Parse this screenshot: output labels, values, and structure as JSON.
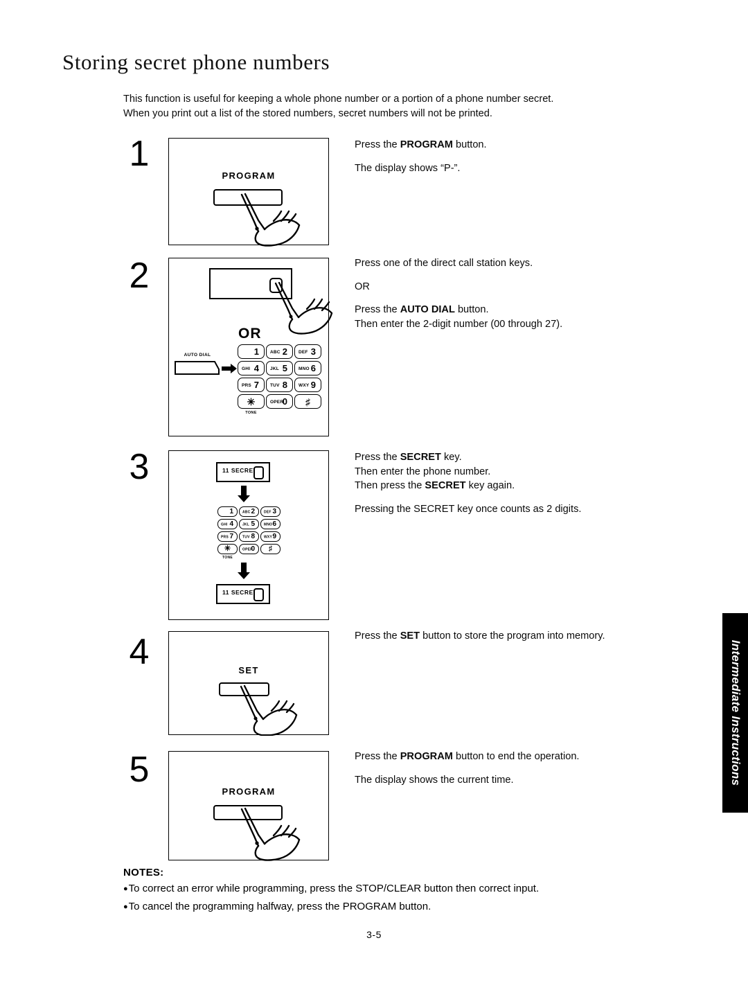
{
  "document": {
    "title": "Storing secret phone numbers",
    "intro_lines": [
      "This function is useful for keeping a whole phone number or a portion of a phone number secret.",
      "When you print out a list of the stored numbers, secret numbers will not be printed."
    ],
    "page_number": "3-5"
  },
  "side_tab": {
    "label": "Intermediate Instructions",
    "background": "#000000",
    "text_color": "#ffffff"
  },
  "steps": [
    {
      "number": "1",
      "figure": {
        "button_label": "PROGRAM",
        "hand": "pointing-hand"
      },
      "text_lines": [
        {
          "prefix": "Press the ",
          "bold": "PROGRAM",
          "suffix": " button."
        },
        {
          "prefix": "",
          "bold": "",
          "suffix": ""
        },
        {
          "prefix": "The display shows “P-”.",
          "bold": "",
          "suffix": ""
        }
      ]
    },
    {
      "number": "2",
      "figure": {
        "or_label": "OR",
        "auto_dial_label": "AUTO DIAL",
        "keypad": [
          [
            {
              "letters": "",
              "digit": "1"
            },
            {
              "letters": "ABC",
              "digit": "2"
            },
            {
              "letters": "DEF",
              "digit": "3"
            }
          ],
          [
            {
              "letters": "GHI",
              "digit": "4"
            },
            {
              "letters": "JKL",
              "digit": "5"
            },
            {
              "letters": "MNO",
              "digit": "6"
            }
          ],
          [
            {
              "letters": "PRS",
              "digit": "7"
            },
            {
              "letters": "TUV",
              "digit": "8"
            },
            {
              "letters": "WXY",
              "digit": "9"
            }
          ],
          [
            {
              "letters": "",
              "digit": "✳",
              "sub": "TONE"
            },
            {
              "letters": "OPER",
              "digit": "0"
            },
            {
              "letters": "",
              "digit": "♯"
            }
          ]
        ]
      },
      "text_lines": [
        {
          "prefix": "Press one of the direct call station keys.",
          "bold": "",
          "suffix": ""
        },
        {
          "prefix": "",
          "bold": "",
          "suffix": ""
        },
        {
          "prefix": "OR",
          "bold": "",
          "suffix": ""
        },
        {
          "prefix": "",
          "bold": "",
          "suffix": ""
        },
        {
          "prefix": "Press the ",
          "bold": "AUTO DIAL",
          "suffix": " button."
        },
        {
          "prefix": "Then enter the 2-digit number (00 through 27).",
          "bold": "",
          "suffix": ""
        }
      ]
    },
    {
      "number": "3",
      "figure": {
        "secret_label_top": "11 SECRET",
        "secret_label_bottom": "11 SECRET",
        "keypad": [
          [
            {
              "letters": "",
              "digit": "1"
            },
            {
              "letters": "ABC",
              "digit": "2"
            },
            {
              "letters": "DEF",
              "digit": "3"
            }
          ],
          [
            {
              "letters": "GHI",
              "digit": "4"
            },
            {
              "letters": "JKL",
              "digit": "5"
            },
            {
              "letters": "MNO",
              "digit": "6"
            }
          ],
          [
            {
              "letters": "PRS",
              "digit": "7"
            },
            {
              "letters": "TUV",
              "digit": "8"
            },
            {
              "letters": "WXY",
              "digit": "9"
            }
          ],
          [
            {
              "letters": "",
              "digit": "✳",
              "sub": "TONE"
            },
            {
              "letters": "OPER",
              "digit": "0"
            },
            {
              "letters": "",
              "digit": "♯"
            }
          ]
        ]
      },
      "text_lines": [
        {
          "prefix": "Press the ",
          "bold": "SECRET",
          "suffix": " key."
        },
        {
          "prefix": "Then enter the phone number.",
          "bold": "",
          "suffix": ""
        },
        {
          "prefix": "Then press the ",
          "bold": "SECRET",
          "suffix": " key again."
        },
        {
          "prefix": "",
          "bold": "",
          "suffix": ""
        },
        {
          "prefix": "Pressing the SECRET key once counts as 2 digits.",
          "bold": "",
          "suffix": ""
        }
      ]
    },
    {
      "number": "4",
      "figure": {
        "button_label": "SET",
        "hand": "pointing-hand"
      },
      "text_lines": [
        {
          "prefix": "Press the ",
          "bold": "SET",
          "suffix": " button to store the program into memory."
        }
      ]
    },
    {
      "number": "5",
      "figure": {
        "button_label": "PROGRAM",
        "hand": "pointing-hand"
      },
      "text_lines": [
        {
          "prefix": "Press the ",
          "bold": "PROGRAM",
          "suffix": " button to end the operation."
        },
        {
          "prefix": "",
          "bold": "",
          "suffix": ""
        },
        {
          "prefix": "The display shows the current time.",
          "bold": "",
          "suffix": ""
        }
      ]
    }
  ],
  "notes": {
    "title": "NOTES:",
    "items": [
      "To correct an error while programming, press the STOP/CLEAR button then correct input.",
      "To cancel the programming halfway, press the PROGRAM button."
    ]
  }
}
